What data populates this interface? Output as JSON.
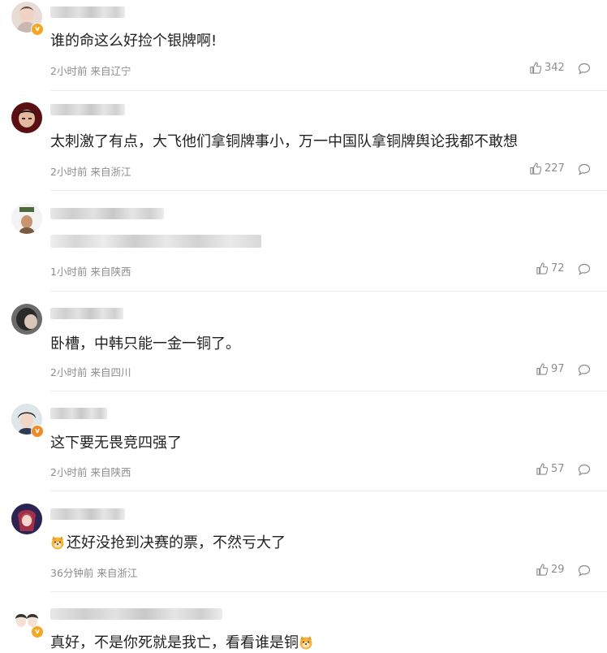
{
  "comments": [
    {
      "text": "谁的命这么好捡个银牌啊!",
      "time": "2小时前",
      "location": "来自辽宁",
      "likes": "342"
    },
    {
      "text": "太刺激了有点，大飞他们拿铜牌事小，万一中国队拿铜牌舆论我都不敢想",
      "time": "2小时前",
      "location": "来自浙江",
      "likes": "227"
    },
    {
      "text": "",
      "time": "1小时前",
      "location": "来自陕西",
      "likes": "72"
    },
    {
      "text": "卧槽，中韩只能一金一铜了。",
      "time": "2小时前",
      "location": "来自四川",
      "likes": "97"
    },
    {
      "text": "这下要无畏竞四强了",
      "time": "2小时前",
      "location": "来自陕西",
      "likes": "57"
    },
    {
      "text": "还好没抢到决赛的票，不然亏大了",
      "time": "36分钟前",
      "location": "来自浙江",
      "likes": "29"
    },
    {
      "text": "真好，不是你死就是我亡，看看谁是铜",
      "time": "",
      "location": "",
      "likes": ""
    }
  ],
  "icons": {
    "like": "thumbs-up-icon",
    "reply": "comment-bubble-icon",
    "emoji": "doge-emoji-icon",
    "verified": "verified-badge-icon"
  }
}
